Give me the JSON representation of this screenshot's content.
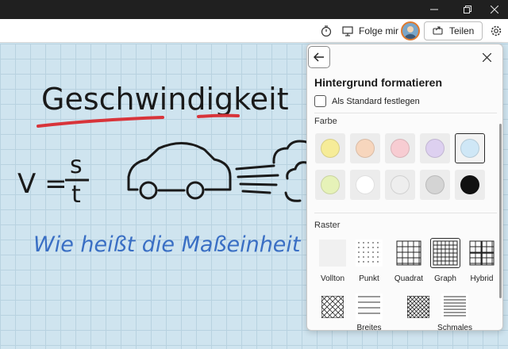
{
  "titlebar": {
    "minimize_icon": "minimize-icon",
    "restore_icon": "restore-icon",
    "close_icon": "close-icon"
  },
  "toolbar": {
    "timer_icon": "timer-icon",
    "follow_label": "Folge mir",
    "share_label": "Teilen",
    "settings_icon": "gear-icon"
  },
  "canvas": {
    "heading": "Geschwindigkeit",
    "formula_left": "V =",
    "formula_num": "s",
    "formula_den": "t",
    "question": "Wie heißt die Maßeinheit ?"
  },
  "panel": {
    "title": "Hintergrund formatieren",
    "default_checkbox_label": "Als Standard festlegen",
    "color_section": "Farbe",
    "colors": [
      {
        "hex": "#f6ec98"
      },
      {
        "hex": "#f7d6bd"
      },
      {
        "hex": "#f7ccd2"
      },
      {
        "hex": "#ddd0f0"
      },
      {
        "hex": "#cfe7f6",
        "selected": true
      },
      {
        "hex": "#e6f2b8"
      },
      {
        "hex": "#ffffff"
      },
      {
        "hex": "#eeeeee"
      },
      {
        "hex": "#d4d4d4"
      },
      {
        "hex": "#111111"
      }
    ],
    "grid_section": "Raster",
    "grids": [
      {
        "label": "Vollton",
        "pattern": "solid"
      },
      {
        "label": "Punkt",
        "pattern": "dot"
      },
      {
        "label": "Quadrat",
        "pattern": "square"
      },
      {
        "label": "Graph",
        "pattern": "graph",
        "selected": true
      },
      {
        "label": "Hybrid",
        "pattern": "hybrid"
      },
      {
        "label": "",
        "pattern": "diamond"
      },
      {
        "label": "Breites",
        "pattern": "wide-lines"
      },
      {
        "label": "",
        "pattern": "diamond-small"
      },
      {
        "label": "Schmales",
        "pattern": "narrow-lines"
      }
    ]
  }
}
